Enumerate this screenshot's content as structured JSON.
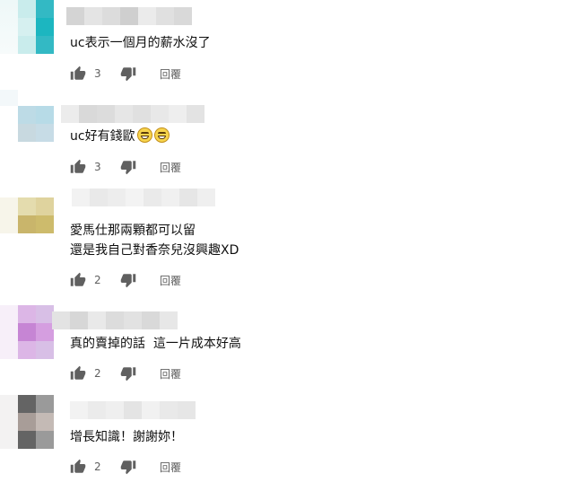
{
  "comments": [
    {
      "text": "uc表示一個月的薪水沒了",
      "likes": "3",
      "reply_label": "回覆",
      "author_blur_colors": [
        "#d4d4d4",
        "#e4e4e4",
        "#dcdcdc",
        "#cfcfcf",
        "#ebebeb",
        "#e0e0e0",
        "#d9d9d9"
      ],
      "avatar_colors": [
        "#c9ecec",
        "#33b9c4",
        "#d6f0f0",
        "#1cb6c0"
      ]
    },
    {
      "text": "uc好有錢歐",
      "emoji_count": 2,
      "likes": "3",
      "reply_label": "回覆",
      "author_blur_colors": [
        "#ececec",
        "#d9d9d9",
        "#dcdcdc",
        "#e6e6e6",
        "#e0e0e0",
        "#e8e8e8",
        "#eeeeee",
        "#e3e3e3"
      ],
      "avatar_colors": [
        "#bddbe6",
        "#b7dbe7",
        "#c8d9e0",
        "#c7dce6"
      ]
    },
    {
      "text": "愛馬仕那兩顆都可以留\n還是我自己對香奈兒沒興趣XD",
      "likes": "2",
      "reply_label": "回覆",
      "author_blur_colors": [
        "#f2f2f2",
        "#e9e9e9",
        "#ededed",
        "#f3f3f3",
        "#eaeaea",
        "#f0f0f0",
        "#e6e6e6",
        "#efefef"
      ],
      "avatar_colors": [
        "#e4dcae",
        "#dfd39e",
        "#c9b56b",
        "#cdbb6c"
      ]
    },
    {
      "text": "真的賣掉的話  這一片成本好高",
      "likes": "2",
      "reply_label": "回覆",
      "author_blur_colors": [
        "#e3e3e3",
        "#d7d7d7",
        "#e9e9e9",
        "#dcdcdc",
        "#e2e2e2",
        "#d9d9d9",
        "#e7e7e7"
      ],
      "avatar_colors": [
        "#dcb6e6",
        "#d8bfe6",
        "#c685d4",
        "#d59ee0"
      ]
    },
    {
      "text": "增長知識！謝謝妳！",
      "likes": "2",
      "reply_label": "回覆",
      "author_blur_colors": [
        "#f2f2f2",
        "#ebebeb",
        "#efefef",
        "#e4e4e4",
        "#f1f1f1",
        "#e9e9e9",
        "#e6e6e6"
      ],
      "avatar_colors": [
        "#646464",
        "#9a9a9a",
        "#a89d98",
        "#c4bab5"
      ]
    }
  ],
  "icons": {
    "like": "thumb-up-icon",
    "dislike": "thumb-down-icon"
  },
  "colors": {
    "text": "#0f0f0f",
    "secondary": "#606060",
    "icon": "#606060"
  }
}
